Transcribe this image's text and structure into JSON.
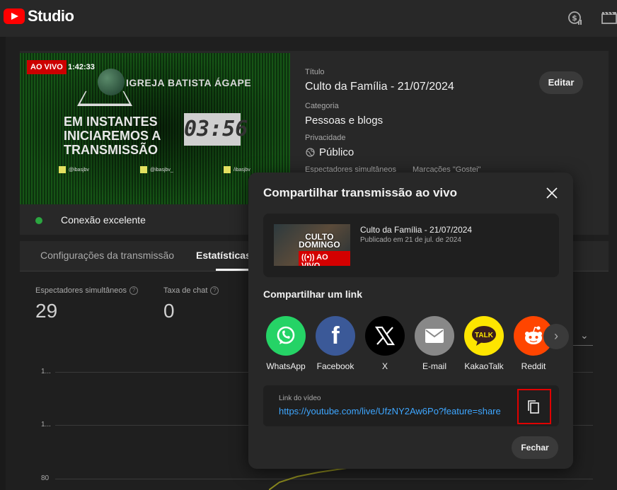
{
  "app": {
    "logo_text": "Studio"
  },
  "header_icons": [
    "monetization-icon",
    "clapper-icon"
  ],
  "preview": {
    "live_badge": "AO VIVO",
    "elapsed": "1:42:33",
    "church_name": "IGREJA BATISTA ÁGAPE",
    "headline_1": "EM INSTANTES",
    "headline_2": "INICIAREMOS A",
    "headline_3": "TRANSMISSÃO",
    "countdown": "03:56",
    "social_1": "@ibasjbv",
    "social_2": "@ibasjbv_",
    "social_3": "/ibasjbv"
  },
  "connection": {
    "status": "Conexão excelente",
    "color": "#2ba640"
  },
  "details": {
    "title_label": "Título",
    "title_value": "Culto da Família - 21/07/2024",
    "edit_label": "Editar",
    "category_label": "Categoria",
    "category_value": "Pessoas e blogs",
    "privacy_label": "Privacidade",
    "privacy_value": "Público",
    "viewers_label": "Espectadores simultâneos",
    "likes_label": "Marcações \"Gostei\""
  },
  "tabs": [
    {
      "label": "Configurações da transmissão",
      "active": false
    },
    {
      "label": "Estatísticas",
      "active": true
    }
  ],
  "stats": {
    "viewers_label": "Espectadores simultâneos",
    "viewers_value": "29",
    "chat_label": "Taxa de chat",
    "chat_value": "0",
    "axis": [
      "1...",
      "1...",
      "80"
    ]
  },
  "modal": {
    "title": "Compartilhar transmissão ao vivo",
    "video": {
      "thumb_title_1": "CULTO",
      "thumb_title_2": "DOMINGO",
      "thumb_live": "AO VIVO",
      "title": "Culto da Família - 21/07/2024",
      "published": "Publicado em 21 de jul. de 2024"
    },
    "share_heading": "Compartilhar um link",
    "share_targets": [
      {
        "label": "WhatsApp",
        "icon": "whatsapp-icon",
        "color": "#25d366"
      },
      {
        "label": "Facebook",
        "icon": "facebook-icon",
        "color": "#3b5998"
      },
      {
        "label": "X",
        "icon": "x-icon",
        "color": "#000000"
      },
      {
        "label": "E-mail",
        "icon": "email-icon",
        "color": "#888888"
      },
      {
        "label": "KakaoTalk",
        "icon": "kakaotalk-icon",
        "color": "#fee500"
      },
      {
        "label": "Reddit",
        "icon": "reddit-icon",
        "color": "#ff4500"
      }
    ],
    "link_label": "Link do vídeo",
    "link_url": "https://youtube.com/live/UfzNY2Aw6Po?feature=share",
    "close_label": "Fechar",
    "kakao_talk_text": "TALK"
  }
}
